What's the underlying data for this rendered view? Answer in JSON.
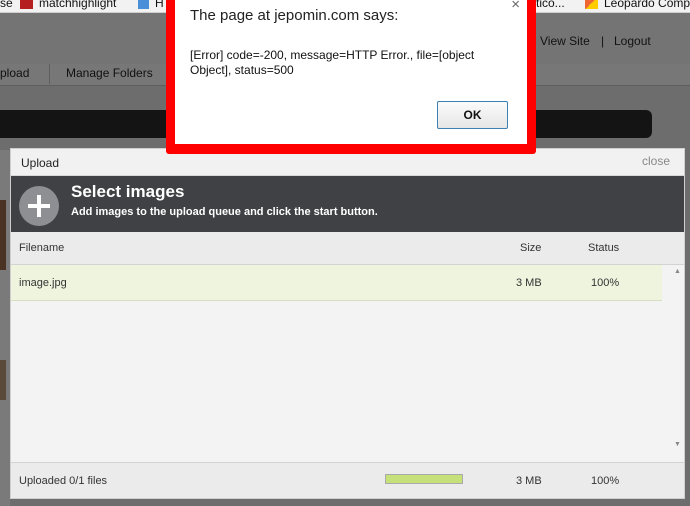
{
  "bookmarks": [
    {
      "label": "se"
    },
    {
      "label": "matchhighlight"
    },
    {
      "label": "H"
    },
    {
      "label": "stico..."
    },
    {
      "label": "Leopardo Comp"
    }
  ],
  "page": {
    "links": {
      "view_site": "View Site",
      "separator": "|",
      "logout": "Logout"
    },
    "nav": {
      "upload": "pload",
      "manage_folders": "Manage Folders"
    }
  },
  "upload": {
    "title": "Upload",
    "close": "close",
    "heading": "Select images",
    "subheading": "Add images to the upload queue and click the start button.",
    "columns": {
      "filename": "Filename",
      "size": "Size",
      "status": "Status"
    },
    "files": [
      {
        "name": "image.jpg",
        "size": "3 MB",
        "status": "100%"
      }
    ],
    "footer": {
      "uploaded": "Uploaded 0/1 files",
      "total_size": "3 MB",
      "total_percent": "100%",
      "progress": 1.0
    }
  },
  "alert": {
    "title": "The page at jepomin.com says:",
    "message": "[Error]  code=-200, message=HTTP Error., file=[object Object], status=500",
    "ok": "OK",
    "close_glyph": "×"
  },
  "colors": {
    "alert_border": "#ff0000",
    "progress": "#c6e07a",
    "selected_row": "#eef4de",
    "header_dark": "#3f4144"
  }
}
